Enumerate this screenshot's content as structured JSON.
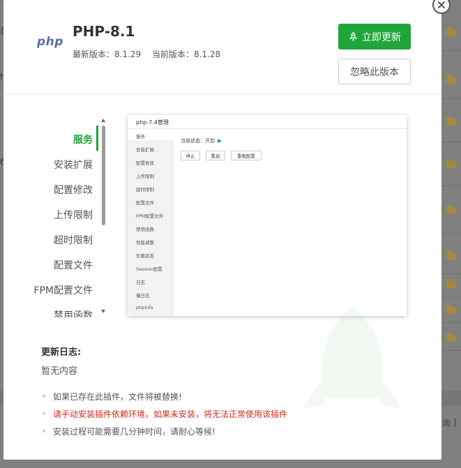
{
  "background": {
    "left_chars": [
      "录",
      "h",
      "6"
    ],
    "right_text": "询",
    "folder_icon": "folder-icon"
  },
  "dialog": {
    "close_icon": "close-icon",
    "logo_text": "php",
    "title": "PHP-8.1",
    "latest_version_label": "最新版本：8.1.29",
    "current_version_label": "当前版本：8.1.28",
    "update_button": "立即更新",
    "update_icon": "rocket-icon",
    "ignore_button": "忽略此版本",
    "accent_color": "#20a53a"
  },
  "nav": {
    "items": [
      "服务",
      "安装扩展",
      "配置修改",
      "上传限制",
      "超时限制",
      "配置文件",
      "FPM配置文件",
      "禁用函数"
    ],
    "active_index": 0
  },
  "preview": {
    "title": "php-7.4管理",
    "side_items": [
      "服务",
      "安装扩展",
      "配置修改",
      "上传限制",
      "超时限制",
      "配置文件",
      "FPM配置文件",
      "禁用函数",
      "性能调整",
      "负载状态",
      "Session配置",
      "日志",
      "慢日志",
      "phpinfo"
    ],
    "status_label": "当前状态：开启",
    "buttons": [
      "停止",
      "重启",
      "重载配置"
    ]
  },
  "changelog": {
    "title": "更新日志:",
    "content": "暂无内容"
  },
  "notes": [
    {
      "text": "如果已存在此插件，文件将被替换!",
      "warn": false
    },
    {
      "text": "请手动安装插件依赖环境，如果未安装，将无法正常使用该插件",
      "warn": true
    },
    {
      "text": "安装过程可能需要几分钟时间，请耐心等候!",
      "warn": false
    }
  ]
}
